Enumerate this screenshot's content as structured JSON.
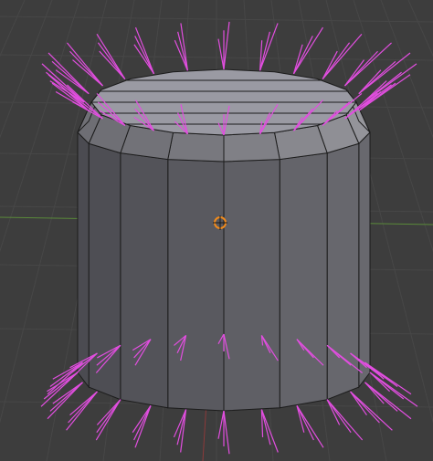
{
  "viewport": {
    "editor": "3D Viewport",
    "background": "#3d3d3d",
    "grid_color": "#474747",
    "x_axis_color": "#8c3a3a",
    "y_axis_color": "#5a8a3a"
  },
  "mesh": {
    "object": "cylinder",
    "shading": "solid",
    "face_color_front": "#5e5e66",
    "face_color_lit": "#8a8a93",
    "top_cap_color": "#9a9aa3",
    "edge_color": "#1c1c1c",
    "normals_color": "#e24ee0",
    "overlay": "vertex-normals"
  },
  "origin": {
    "icon": "object-origin-icon",
    "color": "#f08a1c"
  }
}
